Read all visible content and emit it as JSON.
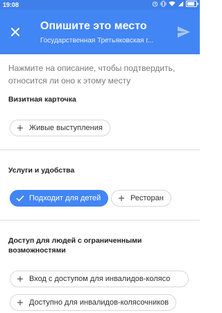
{
  "status_bar": {
    "time": "19:08",
    "battery_level": 0.85
  },
  "header": {
    "title": "Опишите это место",
    "subtitle": "Государственная Третьяковская г...",
    "close_icon": "close-icon",
    "send_icon": "send-icon"
  },
  "instruction": "Нажмите на описание, чтобы подтвердить, относится ли оно к этому месту",
  "sections": [
    {
      "title": "Визитная карточка",
      "chips": [
        {
          "label": "Живые выступления",
          "selected": false
        }
      ]
    },
    {
      "title": "Услуги и удобства",
      "chips": [
        {
          "label": "Подходит для детей",
          "selected": true
        },
        {
          "label": "Ресторан",
          "selected": false
        }
      ]
    },
    {
      "title": "Доступ для людей с ограниченными возможностями",
      "chips": [
        {
          "label": "Вход с доступом для инвалидов-колясо",
          "selected": false
        },
        {
          "label": "Доступно для инвалидов-колясочников",
          "selected": false
        }
      ]
    }
  ],
  "colors": {
    "accent": "#4285f4",
    "status_bar": "#3f7fea",
    "muted_text": "#7a7a7a",
    "divider": "#dcdcdc"
  }
}
